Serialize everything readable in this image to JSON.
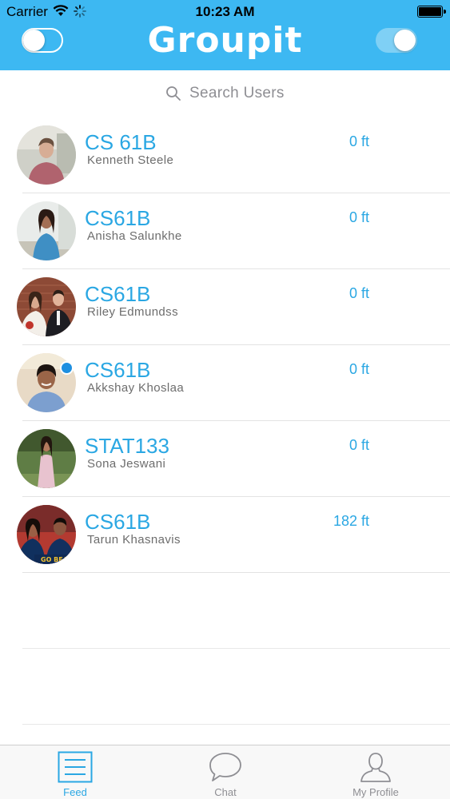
{
  "status_bar": {
    "carrier": "Carrier",
    "time": "10:23 AM"
  },
  "header": {
    "title": "Groupit",
    "left_toggle_on": false,
    "right_toggle_on": true
  },
  "search": {
    "placeholder": "Search Users"
  },
  "users": [
    {
      "course": "CS 61B",
      "name": "Kenneth Steele",
      "distance": "0 ft",
      "online": false
    },
    {
      "course": "CS61B",
      "name": "Anisha Salunkhe",
      "distance": "0 ft",
      "online": false
    },
    {
      "course": "CS61B",
      "name": "Riley Edmundss",
      "distance": "0 ft",
      "online": false
    },
    {
      "course": "CS61B",
      "name": "Akkshay Khoslaa",
      "distance": "0 ft",
      "online": true
    },
    {
      "course": "STAT133",
      "name": "Sona Jeswani",
      "distance": "0 ft",
      "online": false
    },
    {
      "course": "CS61B",
      "name": "Tarun Khasnavis",
      "distance": "182 ft",
      "online": false
    }
  ],
  "tabs": [
    {
      "label": "Feed",
      "icon": "feed-list-icon",
      "active": true
    },
    {
      "label": "Chat",
      "icon": "chat-bubble-icon",
      "active": false
    },
    {
      "label": "My Profile",
      "icon": "profile-person-icon",
      "active": false
    }
  ],
  "colors": {
    "brand": "#3db8f2",
    "accent_text": "#2aa7e3",
    "online_dot": "#1e8fe0"
  }
}
